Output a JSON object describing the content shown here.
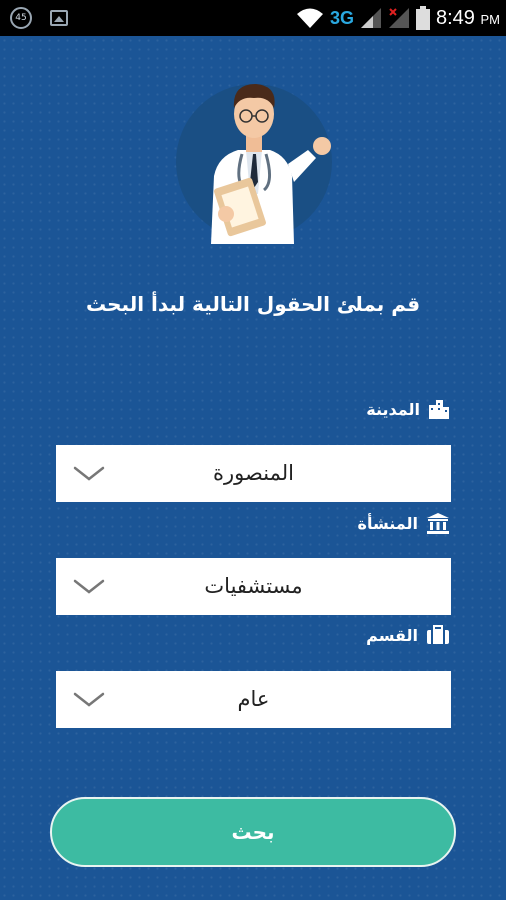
{
  "status_bar": {
    "notification_badge": "45",
    "network_type": "3G",
    "time": "8:49",
    "time_suffix": "PM"
  },
  "heading": "قم بملئ الحقول التالية لبدأ البحث",
  "fields": [
    {
      "label": "المدينة",
      "icon": "city-buildings-icon",
      "value": "المنصورة"
    },
    {
      "label": "المنشأة",
      "icon": "institution-icon",
      "value": "مستشفيات"
    },
    {
      "label": "القسم",
      "icon": "briefcase-icon",
      "value": "عام"
    }
  ],
  "search_button": "بحث",
  "colors": {
    "background": "#1b5596",
    "button": "#3dbba2",
    "status_bar": "#000000"
  }
}
